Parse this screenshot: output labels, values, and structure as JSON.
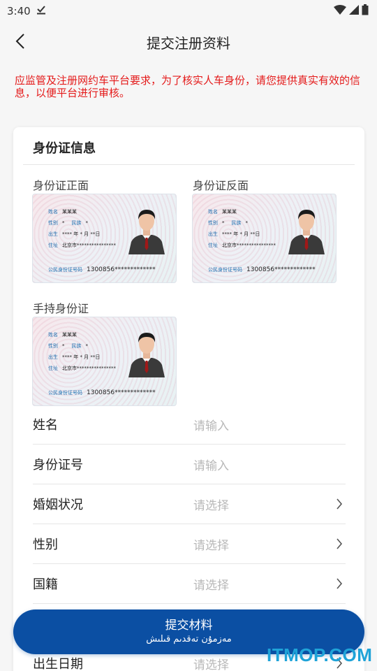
{
  "status_bar": {
    "time": "3:40",
    "icons": [
      "download-done-icon",
      "wifi-icon",
      "signal-icon",
      "battery-icon"
    ]
  },
  "header": {
    "title": "提交注册资料",
    "back_icon": "back-arrow-icon"
  },
  "notice": "应监管及注册网约车平台要求，为了核实人车身份，请您提供真实有效的信息，以便平台进行审核。",
  "card": {
    "title": "身份证信息",
    "id_front_label": "身份证正面",
    "id_back_label": "身份证反面",
    "id_hand_label": "手持身份证",
    "sample": {
      "name_k": "姓名",
      "name_v": "某某某",
      "sex_k": "性别",
      "sex_v": "*",
      "nation_k": "民族",
      "nation_v": "*",
      "birth_k": "出生",
      "birth_v": "****  年  *  月  **日",
      "addr_k": "住址",
      "addr_v": "北京市****************",
      "num_k": "公民身份证号码",
      "num_v": "1300856*************"
    },
    "fields": [
      {
        "label": "姓名",
        "placeholder": "请输入",
        "chevron": false
      },
      {
        "label": "身份证号",
        "placeholder": "请输入",
        "chevron": false
      },
      {
        "label": "婚姻状况",
        "placeholder": "请选择",
        "chevron": true
      },
      {
        "label": "性别",
        "placeholder": "请选择",
        "chevron": true
      },
      {
        "label": "国籍",
        "placeholder": "请选择",
        "chevron": true
      },
      {
        "label": "出生日期",
        "placeholder": "请选择",
        "chevron": true
      }
    ]
  },
  "submit": {
    "label": "提交材料",
    "sublabel": "مەزمۇن تەقدىم قىلىش"
  },
  "watermark": "ITMOP.COM",
  "colors": {
    "accent": "#0b4fa3",
    "notice": "#e41a1a",
    "watermark": "#1fa3d8"
  }
}
